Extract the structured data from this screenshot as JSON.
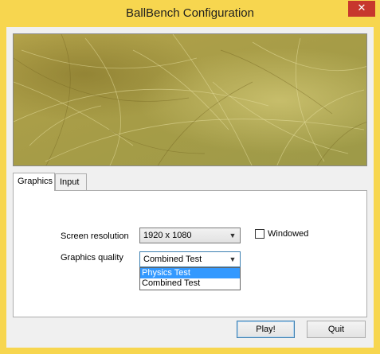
{
  "window": {
    "title": "BallBench Configuration",
    "close_symbol": "✕",
    "frame_color": "#f7d64f",
    "close_color": "#c7372d"
  },
  "banner": {
    "icon": "scratched-gold-texture-image"
  },
  "tabs": [
    {
      "label": "Graphics",
      "active": true
    },
    {
      "label": "Input",
      "active": false
    }
  ],
  "graphics": {
    "resolution_label": "Screen resolution",
    "resolution_value": "1920 x 1080",
    "windowed_label": "Windowed",
    "windowed_checked": false,
    "quality_label": "Graphics quality",
    "quality_value": "Combined Test",
    "quality_options": [
      "Physics Test",
      "Combined Test"
    ],
    "quality_highlighted": "Physics Test"
  },
  "buttons": {
    "play": "Play!",
    "quit": "Quit"
  }
}
